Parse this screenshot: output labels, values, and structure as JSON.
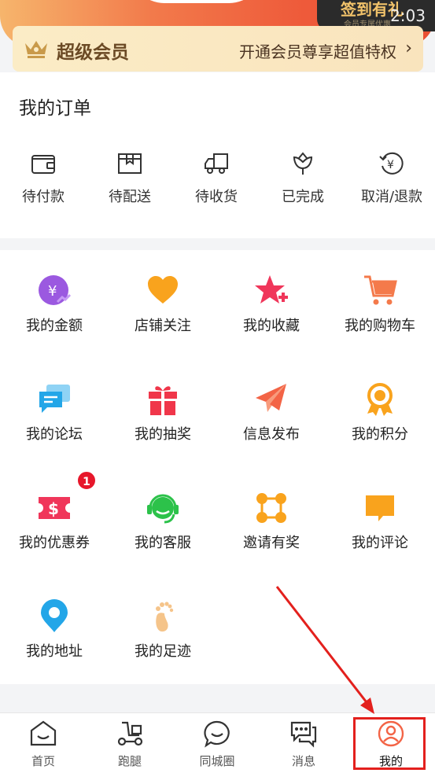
{
  "status": {
    "time": "2:03"
  },
  "sign_in": {
    "label": "签到有礼",
    "sub": "会员专属优惠"
  },
  "vip": {
    "title": "超级会员",
    "promo": "开通会员尊享超值特权",
    "chevron": "›",
    "colors": {
      "bg": "#fbecc6",
      "text": "#6b4a25"
    }
  },
  "orders": {
    "title": "我的订单",
    "items": [
      {
        "label": "待付款",
        "icon": "wallet-icon"
      },
      {
        "label": "待配送",
        "icon": "package-icon"
      },
      {
        "label": "待收货",
        "icon": "delivery-truck-icon"
      },
      {
        "label": "已完成",
        "icon": "flower-icon"
      },
      {
        "label": "取消/退款",
        "icon": "refund-icon"
      }
    ]
  },
  "services": [
    {
      "label": "我的金额",
      "icon": "money-icon"
    },
    {
      "label": "店铺关注",
      "icon": "heart-icon"
    },
    {
      "label": "我的收藏",
      "icon": "star-plus-icon"
    },
    {
      "label": "我的购物车",
      "icon": "cart-icon"
    },
    {
      "label": "我的论坛",
      "icon": "chat-bubbles-icon"
    },
    {
      "label": "我的抽奖",
      "icon": "gift-icon"
    },
    {
      "label": "信息发布",
      "icon": "paper-plane-icon"
    },
    {
      "label": "我的积分",
      "icon": "medal-icon"
    },
    {
      "label": "我的优惠券",
      "icon": "coupon-icon"
    },
    {
      "label": "我的客服",
      "icon": "headset-icon"
    },
    {
      "label": "邀请有奖",
      "icon": "network-icon"
    },
    {
      "label": "我的评论",
      "icon": "comment-icon"
    },
    {
      "label": "我的地址",
      "icon": "location-pin-icon"
    },
    {
      "label": "我的足迹",
      "icon": "footprint-icon"
    }
  ],
  "coupon_badge": "1",
  "nav": [
    {
      "label": "首页",
      "icon": "home-icon"
    },
    {
      "label": "跑腿",
      "icon": "scooter-icon"
    },
    {
      "label": "同城圈",
      "icon": "smile-bubble-icon"
    },
    {
      "label": "消息",
      "icon": "message-icon"
    },
    {
      "label": "我的",
      "icon": "profile-icon",
      "active": true
    }
  ]
}
